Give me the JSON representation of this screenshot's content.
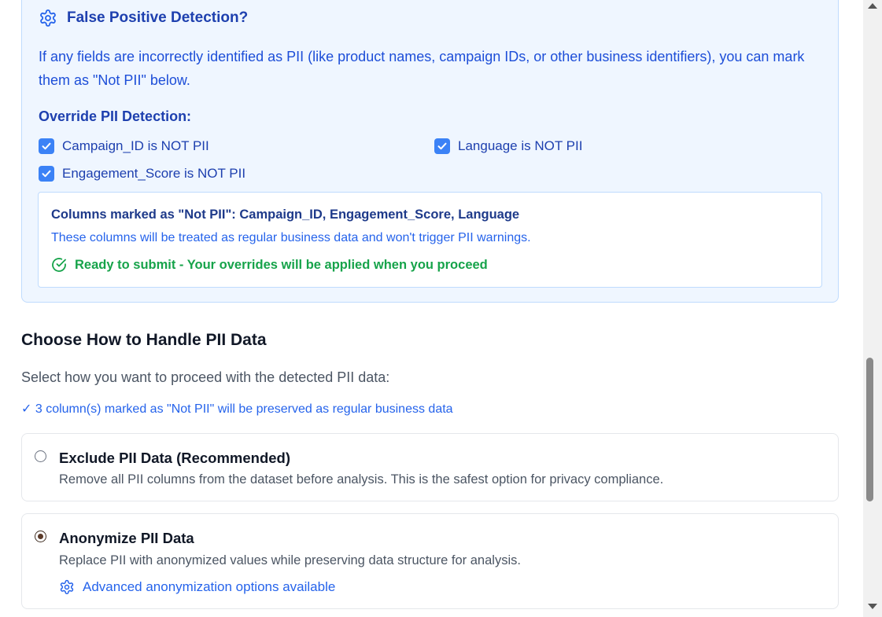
{
  "false_positive": {
    "title": "False Positive Detection?",
    "description": "If any fields are incorrectly identified as PII (like product names, campaign IDs, or other business identifiers), you can mark them as \"Not PII\" below.",
    "override_heading": "Override PII Detection:",
    "overrides": [
      {
        "label": "Campaign_ID is NOT PII",
        "checked": true
      },
      {
        "label": "Language is NOT PII",
        "checked": true
      },
      {
        "label": "Engagement_Score is NOT PII",
        "checked": true
      }
    ],
    "summary": {
      "title": "Columns marked as \"Not PII\": Campaign_ID, Engagement_Score, Language",
      "note": "These columns will be treated as regular business data and won't trigger PII warnings.",
      "ready": "Ready to submit - Your overrides will be applied when you proceed"
    }
  },
  "handling": {
    "title": "Choose How to Handle PII Data",
    "subtitle": "Select how you want to proceed with the detected PII data:",
    "preserved_note": "✓ 3 column(s) marked as \"Not PII\" will be preserved as regular business data",
    "options": [
      {
        "title": "Exclude PII Data (Recommended)",
        "description": "Remove all PII columns from the dataset before analysis. This is the safest option for privacy compliance.",
        "selected": false
      },
      {
        "title": "Anonymize PII Data",
        "description": "Replace PII with anonymized values while preserving data structure for analysis.",
        "link": "Advanced anonymization options available",
        "selected": true
      }
    ]
  },
  "icons": {
    "title_icon": "gear-icon",
    "ready_icon": "check-circle-icon",
    "link_icon": "gear-icon"
  },
  "colors": {
    "accent_blue": "#2563eb",
    "panel_bg": "#eff6ff",
    "success_green": "#16a34a"
  }
}
